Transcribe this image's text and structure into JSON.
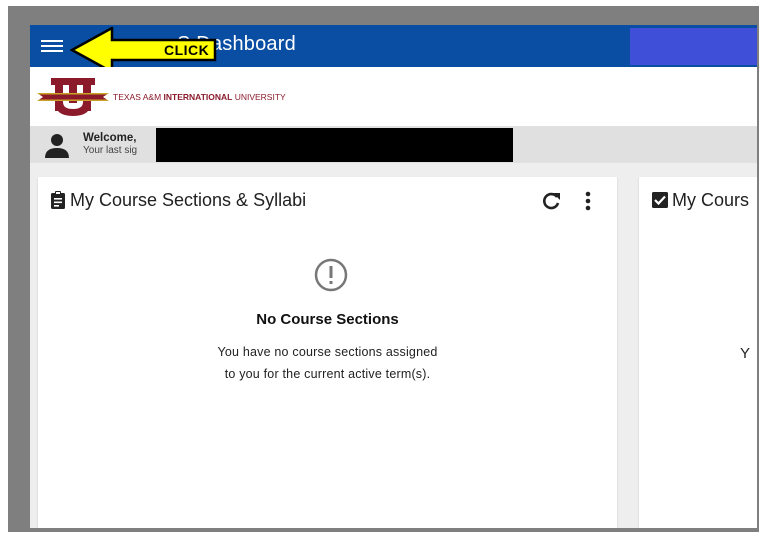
{
  "header": {
    "title": "S Dashboard",
    "menu_icon": "hamburger-menu-icon",
    "accent_color": "#0a4ea3"
  },
  "callout": {
    "text": "CLICK",
    "fill_color": "#ffff00"
  },
  "logo": {
    "name_regular_1": "TEXAS A&M ",
    "name_bold": "INTERNATIONAL",
    "name_regular_2": " UNIVERSITY"
  },
  "welcome": {
    "greeting": "Welcome,",
    "last_signin_prefix": "Your last sig"
  },
  "cards": {
    "sections": {
      "title": "My Course Sections & Syllabi",
      "empty_title": "No Course Sections",
      "empty_line1": "You have no course sections assigned",
      "empty_line2": "to you for the current active term(s)."
    },
    "second": {
      "title": "My Cours",
      "text_fragment": "Y"
    }
  }
}
